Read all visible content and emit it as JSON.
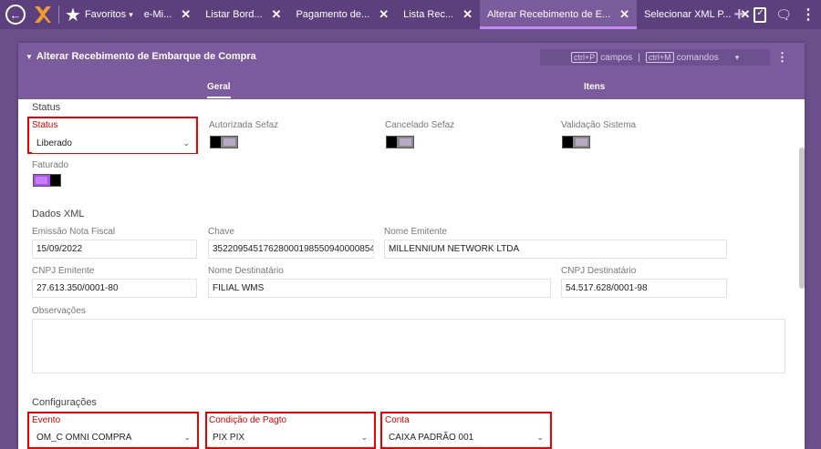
{
  "topbar": {
    "favorites_label": "Favoritos",
    "tabs": [
      {
        "label": "e-Mi..."
      },
      {
        "label": "Listar Bord..."
      },
      {
        "label": "Pagamento de..."
      },
      {
        "label": "Lista Rec..."
      },
      {
        "label": "Alterar Recebimento de E..."
      },
      {
        "label": "Selecionar XML P..."
      }
    ],
    "accent": "#c38cf2"
  },
  "dialog": {
    "title": "Alterar Recebimento de Embarque de Compra",
    "shortcut_fields_key": "ctrl+P",
    "shortcut_fields_label": "campos",
    "shortcut_sep": "|",
    "shortcut_commands_key": "ctrl+M",
    "shortcut_commands_label": "comandos",
    "tabs": [
      {
        "label": "Geral"
      },
      {
        "label": "Itens"
      }
    ]
  },
  "status": {
    "section_title": "Status",
    "status_label": "Status",
    "status_value": "Liberado",
    "autorizada_label": "Autorizada Sefaz",
    "cancelado_label": "Cancelado Sefaz",
    "validacao_label": "Validação Sistema",
    "faturado_label": "Faturado"
  },
  "xml": {
    "section_title": "Dados XML",
    "emissao_label": "Emissão Nota Fiscal",
    "emissao_value": "15/09/2022",
    "chave_label": "Chave",
    "chave_value": "35220954517628000198550940000854",
    "emitente_label": "Nome Emitente",
    "emitente_value": "MILLENNIUM NETWORK LTDA",
    "cnpj_emitente_label": "CNPJ Emitente",
    "cnpj_emitente_value": "27.613.350/0001-80",
    "destinatario_label": "Nome Destinatário",
    "destinatario_value": "FILIAL WMS",
    "cnpj_dest_label": "CNPJ Destinatário",
    "cnpj_dest_value": "54.517.628/0001-98",
    "obs_label": "Observações",
    "obs_value": ""
  },
  "config": {
    "section_title": "Configurações",
    "evento_label": "Evento",
    "evento_value": "OM_C OMNI COMPRA",
    "condicao_label": "Condição de Pagto",
    "condicao_value": "PIX PIX",
    "conta_label": "Conta",
    "conta_value": "CAIXA PADRÃO 001"
  }
}
